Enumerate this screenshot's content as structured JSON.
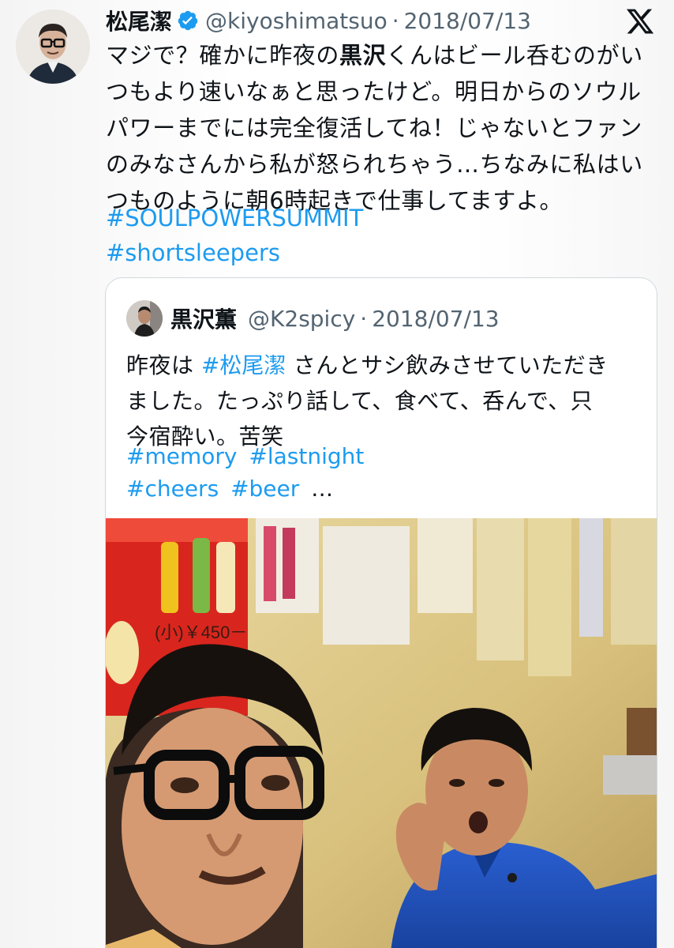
{
  "tweet": {
    "author": {
      "name": "松尾潔",
      "handle": "@kiyoshimatsuo",
      "verified": true
    },
    "date": "2018/07/13",
    "separator": "·",
    "text_lines": [
      [
        "マジで？確かに昨夜の",
        "黒沢",
        "くんはビール呑むのがい"
      ],
      "つもより速いなぁと思ったけど。明日からのソウル",
      "パワーまでには完全復活してね！じゃないとファン",
      "のみなさんから私が怒られちゃう…ちなみに私はい",
      "つものように朝6時起きで仕事してますよ。"
    ],
    "hashtags": [
      "#SOULPOWERSUMMIT",
      "#shortsleepers"
    ],
    "platform_icon": "x-logo-icon"
  },
  "quoted_tweet": {
    "author": {
      "name": "黒沢薫",
      "handle": "@K2spicy"
    },
    "separator": "·",
    "date": "2018/07/13",
    "text_line1_prefix": "昨夜は ",
    "text_line1_tag": "#松尾潔",
    "text_line1_suffix": " さんとサシ飲みさせていただき",
    "text_line2": "ました。たっぷり話して、食べて、呑んで、只",
    "text_line3": "今宿酔い。苦笑",
    "hashtags_row1": [
      "#memory",
      "#lastnight"
    ],
    "hashtags_row2": [
      "#cheers",
      "#beer"
    ],
    "ellipsis": "…",
    "photo": {
      "description_icon": "selfie-photo",
      "wall_text": "(小)￥450－"
    }
  },
  "colors": {
    "link": "#1d9bf0",
    "muted": "#536471",
    "text": "#0f1419",
    "border": "#cfd9de",
    "verified": "#1d9bf0"
  }
}
